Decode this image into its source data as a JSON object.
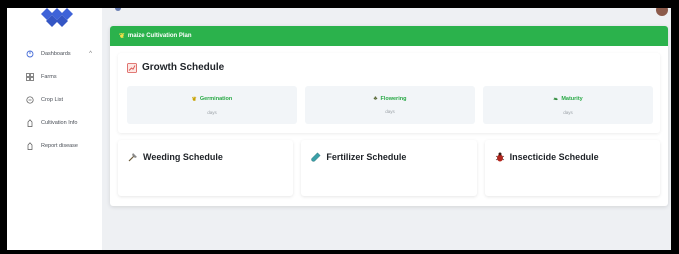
{
  "sidebar": {
    "items": [
      {
        "label": "Dashboards",
        "icon": "dashboard-icon",
        "caret": "^"
      },
      {
        "label": "Farms",
        "icon": "grid-icon"
      },
      {
        "label": "Crop List",
        "icon": "list-icon"
      },
      {
        "label": "Cultivation Info",
        "icon": "info-icon"
      },
      {
        "label": "Report disease",
        "icon": "report-icon"
      }
    ]
  },
  "plan": {
    "header": "maize Cultivation Plan",
    "growth_title": "Growth Schedule",
    "stages": [
      {
        "name": "Germination",
        "unit": "days",
        "icon": "sprout-icon"
      },
      {
        "name": "Flowering",
        "unit": "days",
        "icon": "flower-pot-icon"
      },
      {
        "name": "Maturity",
        "unit": "days",
        "icon": "leaf-icon"
      }
    ],
    "weeding_title": "Weeding Schedule",
    "fertilizer_title": "Fertilizer Schedule",
    "insecticide_title": "Insecticide Schedule"
  },
  "colors": {
    "header_green": "#2bb24c",
    "stage_green": "#27a844",
    "brand_blue": "#3f63d8"
  }
}
